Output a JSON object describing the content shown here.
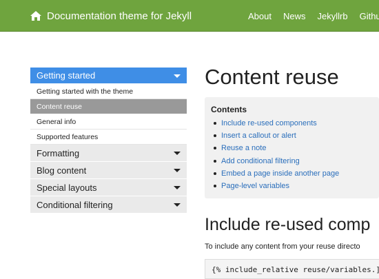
{
  "navbar": {
    "brand": "Documentation theme for Jekyll",
    "links": [
      "About",
      "News",
      "Jekyllrb",
      "Githu"
    ],
    "color": "#6fa43e"
  },
  "sidebar": {
    "sections": [
      {
        "label": "Getting started",
        "expanded": true,
        "items": [
          {
            "label": "Getting started with the theme",
            "active": false
          },
          {
            "label": "Content reuse",
            "active": true
          },
          {
            "label": "General info",
            "active": false
          },
          {
            "label": "Supported features",
            "active": false
          }
        ]
      },
      {
        "label": "Formatting",
        "expanded": false
      },
      {
        "label": "Blog content",
        "expanded": false
      },
      {
        "label": "Special layouts",
        "expanded": false
      },
      {
        "label": "Conditional filtering",
        "expanded": false
      }
    ],
    "accent": "#3f8ee6"
  },
  "main": {
    "title": "Content reuse",
    "toc": {
      "title": "Contents",
      "items": [
        "Include re-used components",
        "Insert a callout or alert",
        "Reuse a note",
        "Add conditional filtering",
        "Embed a page inside another page",
        "Page-level variables"
      ]
    },
    "section_title": "Include re-used comp",
    "paragraph": "To include any content from your reuse directo",
    "code": "{% include_relative reuse/variables.]"
  }
}
